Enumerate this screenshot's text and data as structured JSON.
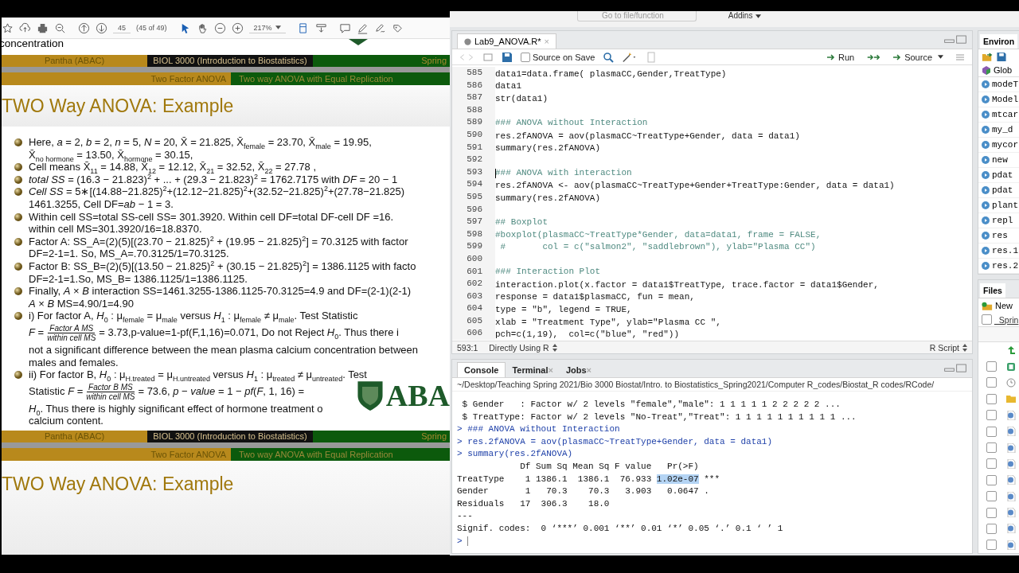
{
  "pdf_toolbar": {
    "page": "45",
    "page_count": "(45 of 49)",
    "zoom": "217%"
  },
  "slide": {
    "top_text": "concentration",
    "header_bands": {
      "author": "Pantha  (ABAC)",
      "course": "BIOL 3000 (Introduction to Biostatistics)",
      "term": "Spring",
      "section": "Two Factor ANOVA",
      "subsection": "Two way ANOVA with Equal Replication"
    },
    "title": "TWO Way ANOVA: Example",
    "bullets": [
      {
        "lines": [
          {
            "kind": "text",
            "text": "Here, *a* = 2, *b* = 2, *n* = 5, *N* = 20, X̄ = 21.825, X̄$_{female}$ = 23.70, X̄$_{male}$ = 19.95,"
          },
          {
            "kind": "text",
            "text": "X̄$_{no hormone}$ = 13.50, X̄$_{hormone}$ = 30.15,"
          }
        ]
      },
      {
        "lines": [
          {
            "kind": "text",
            "text": "Cell means X̄$_{11}$ = 14.88, X̄$_{12}$ = 12.12, X̄$_{21}$ = 32.52, X̄$_{22}$ = 27.78 ,"
          }
        ]
      },
      {
        "lines": [
          {
            "kind": "text",
            "text": "*total SS* = (16.3 − 21.823)$^{2}$ + ... + (29.3 − 21.823)$^{2}$ = 1762.7175 with *DF* = 20 − 1"
          }
        ]
      },
      {
        "lines": [
          {
            "kind": "text",
            "text": "*Cell SS* = 5∗[(14.88−21.825)$^{2}$+(12.12−21.825)$^{2}$+(32.52−21.825)$^{2}$+(27.78−21.825)"
          },
          {
            "kind": "text",
            "text": "1461.3255, Cell DF=*ab* − 1 = 3."
          }
        ]
      },
      {
        "lines": [
          {
            "kind": "text",
            "text": "Within cell SS=total SS-cell SS= 301.3920. Within cell DF=total DF-cell DF =16."
          },
          {
            "kind": "text",
            "text": "within cell MS=301.3920/16=18.8370."
          }
        ]
      },
      {
        "lines": [
          {
            "kind": "text",
            "text": "Factor A: SS_A=(2)(5)[(23.70 − 21.825)$^{2}$ + (19.95 − 21.825)$^{2}$] = 70.3125 with factor"
          },
          {
            "kind": "text",
            "text": "DF=2-1=1. So, MS_A=.70.3125/1=70.3125."
          }
        ]
      },
      {
        "lines": [
          {
            "kind": "text",
            "text": "Factor B: SS_B=(2)(5)[(13.50 − 21.825)$^{2}$ + (30.15 − 21.825)$^{2}$] = 1386.1125 with facto"
          },
          {
            "kind": "text",
            "text": "DF=2-1=1.So, MS_B= 1386.1125/1=1386.1125."
          }
        ]
      },
      {
        "lines": [
          {
            "kind": "text",
            "text": "Finally, *A* × *B* interaction SS=1461.3255-1386.1125-70.3125=4.9 and DF=(2-1)(2-1)"
          },
          {
            "kind": "text",
            "text": "*A* × *B* MS=4.90/1=4.90"
          }
        ]
      },
      {
        "lines": [
          {
            "kind": "text",
            "text": "i) For factor A, *H*$_{0}$ : μ$_{female}$ = μ$_{male}$ versus *H*$_{1}$ : μ$_{female}$ ≠ μ$_{male}$. Test Statistic"
          },
          {
            "kind": "fraction",
            "before": "*F* =",
            "num": "Factor A MS",
            "den": "within cell MS",
            "after": "= 3.73,p-value=1-pf(F,1,16)=0.071, Do not Reject *H*$_{0}$. Thus there i"
          },
          {
            "kind": "text",
            "text": "not a significant difference between the mean plasma calcium concentration between"
          },
          {
            "kind": "text",
            "text": "males and females."
          }
        ]
      },
      {
        "lines": [
          {
            "kind": "text",
            "text": "ii) For factor B, *H*$_{0}$ : μ$_{H.treated}$ = μ$_{H.untreated}$ versus *H*$_{1}$ : μ$_{treated}$ ≠ μ$_{untreated}$. Test"
          },
          {
            "kind": "fraction",
            "before": "Statistic *F* =",
            "num": "Factor B MS",
            "den": "within cell MS",
            "after": "= 73.6, *p* − *value* = 1 − *pf*(*F*, 1, 16) ="
          },
          {
            "kind": "text",
            "text": "*H*$_{0}$. Thus there is highly significant effect of hormone treatment o"
          },
          {
            "kind": "text",
            "text": "calcium content."
          }
        ]
      }
    ],
    "logo_text": "ABA",
    "footer_bands": {
      "author": "Pantha  (ABAC)",
      "course": "BIOL 3000 (Introduction to Biostatistics)",
      "term": "Spring",
      "section": "Two Factor ANOVA",
      "subsection": "Two way ANOVA with Equal Replication"
    },
    "next_title": "TWO Way ANOVA: Example"
  },
  "rstudio": {
    "toolbar": {
      "goto_placeholder": "Go to file/function",
      "addins": "Addins"
    },
    "editor": {
      "tab": {
        "label": "Lab9_ANOVA.R*",
        "close": "×"
      },
      "source_on_save": {
        "label": "Source on Save",
        "checked": false
      },
      "run": "Run",
      "source": "Source",
      "lines": [
        {
          "number": "585",
          "kind": "code",
          "text": "data1=data.frame( plasmaCC,Gender,TreatType)"
        },
        {
          "number": "586",
          "kind": "code",
          "text": "data1"
        },
        {
          "number": "587",
          "kind": "code",
          "text": "str(data1)"
        },
        {
          "number": "588",
          "kind": "blank"
        },
        {
          "number": "589",
          "kind": "comment",
          "text": "### ANOVA without Interaction"
        },
        {
          "number": "590",
          "kind": "code",
          "text": "res.2fANOVA = aov(plasmaCC~TreatType+Gender, data = data1)"
        },
        {
          "number": "591",
          "kind": "code",
          "text": "summary(res.2fANOVA)"
        },
        {
          "number": "592",
          "kind": "blank"
        },
        {
          "number": "593",
          "kind": "comment",
          "text": "### ANOVA with interaction",
          "cursor": true
        },
        {
          "number": "594",
          "kind": "code",
          "text": "res.2fANOVA <- aov(plasmaCC~TreatType+Gender+TreatType:Gender, data = data1)"
        },
        {
          "number": "595",
          "kind": "code",
          "text": "summary(res.2fANOVA)"
        },
        {
          "number": "596",
          "kind": "blank"
        },
        {
          "number": "597",
          "kind": "comment",
          "text": "## Boxplot"
        },
        {
          "number": "598",
          "kind": "comment",
          "text": "#boxplot(plasmaCC~TreatType*Gender, data=data1, frame = FALSE,"
        },
        {
          "number": "599",
          "kind": "comment",
          "text": " #       col = c(\"salmon2\", \"saddlebrown\"), ylab=\"Plasma CC\")"
        },
        {
          "number": "600",
          "kind": "blank"
        },
        {
          "number": "601",
          "kind": "comment",
          "text": "### Interaction Plot"
        },
        {
          "number": "602",
          "kind": "code",
          "text": "interaction.plot(x.factor = data1$TreatType, trace.factor = data1$Gender,"
        },
        {
          "number": "603",
          "kind": "code",
          "text": "response = data1$plasmaCC, fun = mean,"
        },
        {
          "number": "604",
          "kind": "code",
          "text": "type = \"b\", legend = TRUE,"
        },
        {
          "number": "605",
          "kind": "code",
          "text": "xlab = \"Treatment Type\", ylab=\"Plasma CC \","
        },
        {
          "number": "606",
          "kind": "code",
          "text": "pch=c(1,19),  col=c(\"blue\", \"red\"))"
        }
      ],
      "status": {
        "position": "593:1",
        "mode": "Directly Using R",
        "file_type": "R Script"
      }
    },
    "console": {
      "tabs": [
        {
          "label": "Console",
          "selected": true
        },
        {
          "label": "Terminal",
          "selected": false,
          "close": "×"
        },
        {
          "label": "Jobs",
          "selected": false,
          "close": "×"
        }
      ],
      "path": "~/Desktop/Teaching Spring 2021/Bio 3000 Biostat/Intro. to Biostatistics_Spring2021/Computer R_codes/Biostat_R codes/RCode/",
      "lines": [
        {
          "kind": "output",
          "segments": [
            {
              "text": " $ Gender   : Factor w/ 2 levels \"female\",\"male\": 1 1 1 1 1 2 2 2 2 2 ...",
              "selected": false
            }
          ]
        },
        {
          "kind": "output",
          "segments": [
            {
              "text": " $ TreatType: Factor w/ 2 levels \"No-Treat\",\"Treat\": 1 1 1 1 1 1 1 1 1 1 ...",
              "selected": false
            }
          ]
        },
        {
          "kind": "input",
          "segments": [
            {
              "text": "> ### ANOVA without Interaction",
              "selected": false
            }
          ]
        },
        {
          "kind": "input",
          "segments": [
            {
              "text": "> res.2fANOVA = aov(plasmaCC~TreatType+Gender, data = data1)",
              "selected": false
            }
          ]
        },
        {
          "kind": "input",
          "segments": [
            {
              "text": "> summary(res.2fANOVA)",
              "selected": false
            }
          ]
        },
        {
          "kind": "output",
          "segments": [
            {
              "text": "            Df Sum Sq Mean Sq F value   Pr(>F)",
              "selected": false
            }
          ]
        },
        {
          "kind": "output",
          "segments": [
            {
              "text": "TreatType    1 1386.1  1386.1  76.933 ",
              "selected": false
            },
            {
              "text": "1.02e-07",
              "selected": true
            },
            {
              "text": " ***",
              "selected": false
            }
          ]
        },
        {
          "kind": "output",
          "segments": [
            {
              "text": "Gender       1   70.3    70.3   3.903   0.0647 .",
              "selected": false
            }
          ]
        },
        {
          "kind": "output",
          "segments": [
            {
              "text": "Residuals   17  306.3    18.0",
              "selected": false
            }
          ]
        },
        {
          "kind": "output",
          "segments": [
            {
              "text": "---",
              "selected": false
            }
          ]
        },
        {
          "kind": "output",
          "segments": [
            {
              "text": "Signif. codes:  0 ‘***’ 0.001 ‘**’ 0.01 ‘*’ 0.05 ‘.’ 0.1 ‘ ’ 1",
              "selected": false
            }
          ]
        },
        {
          "kind": "input",
          "segments": [
            {
              "text": ">",
              "selected": false
            }
          ],
          "cursor": true
        }
      ]
    },
    "environment": {
      "tab": "Environ",
      "scope": "Glob",
      "objects": [
        "modeT",
        "Model",
        "mtcar",
        "my_d",
        "mycor",
        "new",
        "pdat",
        "pdat",
        "plant",
        "repl",
        "res",
        "res.1",
        "res.2"
      ]
    },
    "files": {
      "tab": "Files",
      "new": "New",
      "folder": "_Sprin",
      "rows": [
        {
          "kind": "up"
        },
        {
          "kind": "rdoc",
          "checked": false
        },
        {
          "kind": "history",
          "checked": false
        },
        {
          "kind": "folder",
          "checked": false
        },
        {
          "kind": "rscript",
          "checked": false
        },
        {
          "kind": "rscript",
          "checked": false
        },
        {
          "kind": "rscript",
          "checked": false
        },
        {
          "kind": "rscript",
          "checked": false
        },
        {
          "kind": "rscript",
          "checked": false
        },
        {
          "kind": "rscript",
          "checked": false
        },
        {
          "kind": "rscript",
          "checked": false
        },
        {
          "kind": "rscript",
          "checked": false
        },
        {
          "kind": "rscript",
          "checked": false
        }
      ]
    }
  }
}
